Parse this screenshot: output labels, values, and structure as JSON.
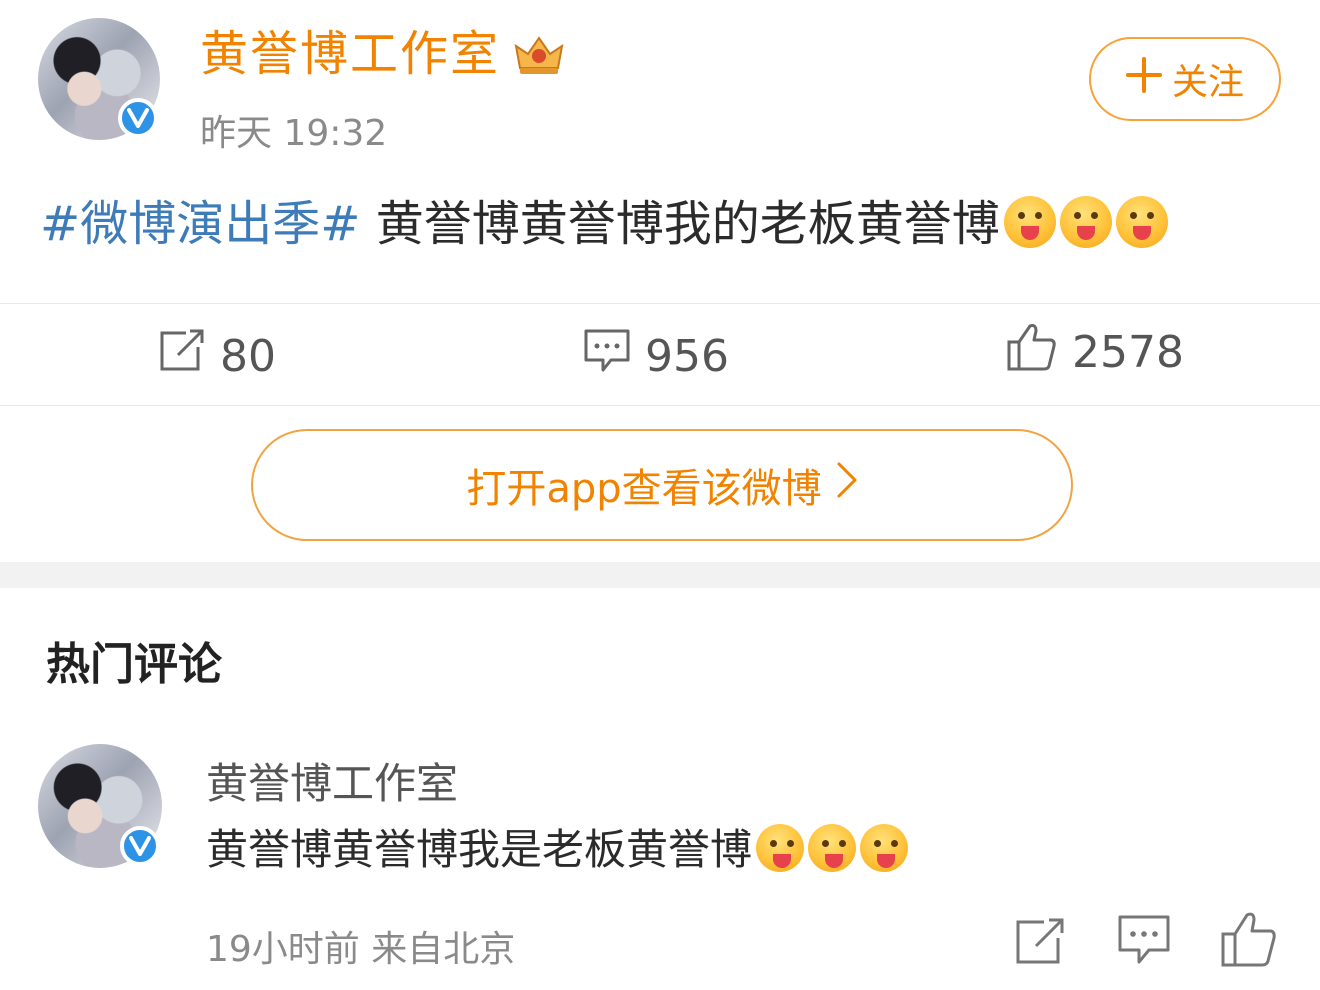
{
  "post": {
    "author": "黄誉博工作室",
    "time": "昨天 19:32",
    "follow_label": "关注",
    "topic": "#微博演出季#",
    "text": " 黄誉博黄誉博我的老板黄誉博",
    "emoji_icon": "tongue-out-emoji"
  },
  "stats": {
    "reposts": "80",
    "comments": "956",
    "likes": "2578"
  },
  "open_app_label": "打开app查看该微博",
  "hot_comments_title": "热门评论",
  "comment": {
    "author": "黄誉博工作室",
    "text": "黄誉博黄誉博我是老板黄誉博",
    "meta": "19小时前 来自北京"
  },
  "colors": {
    "accent_orange": "#f18300",
    "topic_blue": "#3e7bb9",
    "verified_blue": "#2d93e6"
  }
}
